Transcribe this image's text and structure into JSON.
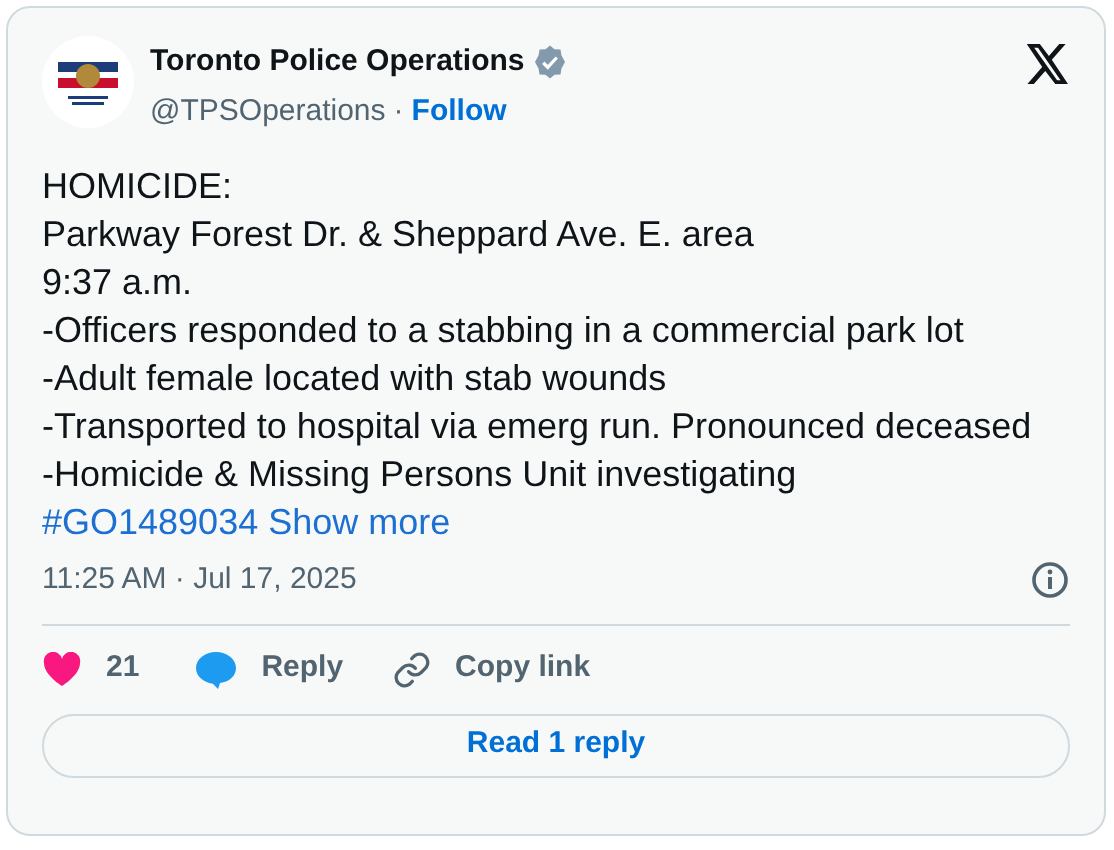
{
  "author": {
    "name": "Toronto Police Operations",
    "verified": true,
    "handle": "@TPSOperations",
    "separator": "·",
    "follow": "Follow"
  },
  "body": {
    "lines": [
      "HOMICIDE:",
      "Parkway Forest Dr. & Sheppard Ave. E. area",
      "9:37 a.m.",
      "-Officers responded to a stabbing in a commercial park lot",
      "-Adult female located with stab wounds",
      "-Transported to hospital via emerg run. Pronounced deceased",
      "-Homicide & Missing Persons Unit investigating"
    ],
    "hashtag": "#GO1489034",
    "show_more": "Show more"
  },
  "timestamp": "11:25 AM · Jul 17, 2025",
  "actions": {
    "likes": "21",
    "reply": "Reply",
    "copy_link": "Copy link"
  },
  "read_replies": "Read 1 reply"
}
